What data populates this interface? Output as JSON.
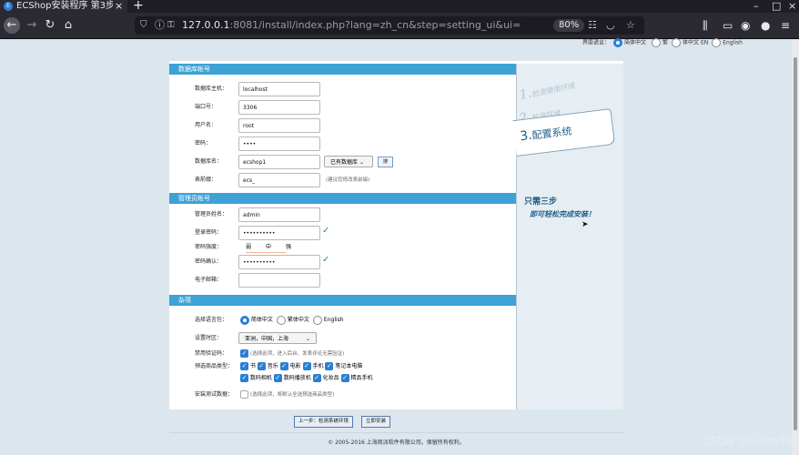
{
  "browser": {
    "tab_title": "ECShop安装程序 第3步",
    "url_host": "127.0.0.1",
    "url_rest": ":8081/install/index.php?lang=zh_cn&step=setting_ui&ui=",
    "zoom": "80%"
  },
  "lang_selector": {
    "label": "界面语言：",
    "options": [
      "简体中文",
      "繁",
      "体中文",
      "EN",
      "English"
    ],
    "selected": "简体中文"
  },
  "db_section": {
    "title": "数据库帐号",
    "host_label": "数据库主机：",
    "host_value": "localhost",
    "port_label": "端口号：",
    "port_value": "3306",
    "user_label": "用户名：",
    "user_value": "root",
    "pass_label": "密码：",
    "pass_value": "••••",
    "name_label": "数据库名：",
    "name_value": "ecshop1",
    "existing_db": "已有数据库",
    "search_btn": "搜",
    "prefix_label": "表前缀：",
    "prefix_value": "ecs_",
    "prefix_hint": "(建议您修改表前缀)"
  },
  "admin_section": {
    "title": "管理员帐号",
    "name_label": "管理员姓名：",
    "name_value": "admin",
    "pass_label": "登录密码：",
    "pass_value": "••••••••••",
    "strength_label": "密码强度：",
    "weak": "弱",
    "medium": "中",
    "strong": "强",
    "confirm_label": "密码确认：",
    "confirm_value": "••••••••••",
    "email_label": "电子邮箱："
  },
  "misc_section": {
    "title": "杂项",
    "lang_label": "选择语言包：",
    "lang_opts": [
      "简体中文",
      "繁体中文",
      "English"
    ],
    "tz_label": "设置时区：",
    "tz_value": "亚洲，中国，上海",
    "captcha_label": "禁用验证码：",
    "captcha_hint": "(选择此项，进入后台、发表评论无需验证)",
    "goods_label": "预选商品类型：",
    "goods_types": [
      "书",
      "音乐",
      "电影",
      "手机",
      "笔记本电脑",
      "数码相机",
      "数码播放机",
      "化妆品",
      "精品手机"
    ],
    "test_label": "安装测试数据：",
    "test_hint": "(选择此项，将默认全选预选商品类型)"
  },
  "steps": {
    "s1": "检测使用环境",
    "s2": "检测环境",
    "s3": "配置系统",
    "n1": "1.",
    "n2": "2.",
    "n3": "3.",
    "slogan1": "只需三步",
    "slogan2": "即可轻松完成安装！"
  },
  "buttons": {
    "prev": "上一步：检测系统环境",
    "install": "立即安装"
  },
  "footer": "© 2005-2016 上海商派软件有限公司。保留所有权利。",
  "watermark": "CSDN @GuiltyFet"
}
